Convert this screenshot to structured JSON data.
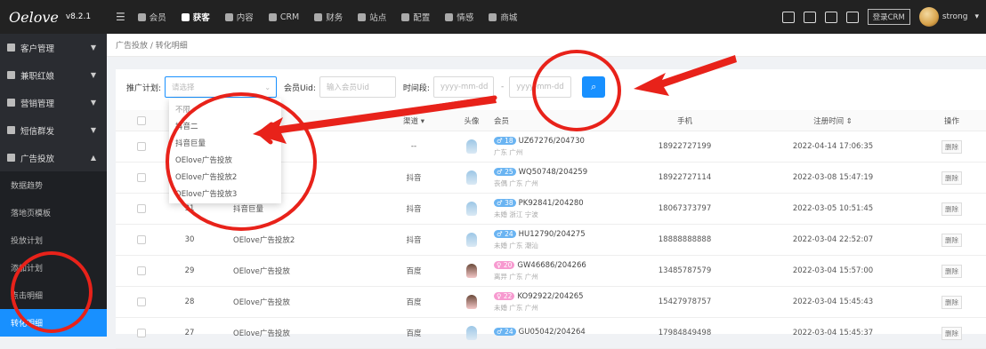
{
  "app": {
    "brand": "Oelove",
    "version": "v8.2.1"
  },
  "topnav": [
    {
      "label": "会员",
      "icon": "users-icon",
      "active": false
    },
    {
      "label": "获客",
      "icon": "user-icon",
      "active": true
    },
    {
      "label": "内容",
      "icon": "content-icon",
      "active": false
    },
    {
      "label": "CRM",
      "icon": "crm-icon",
      "active": false
    },
    {
      "label": "财务",
      "icon": "finance-icon",
      "active": false
    },
    {
      "label": "站点",
      "icon": "site-icon",
      "active": false
    },
    {
      "label": "配置",
      "icon": "gear-icon",
      "active": false
    },
    {
      "label": "情感",
      "icon": "heart-icon",
      "active": false
    },
    {
      "label": "商城",
      "icon": "shop-icon",
      "active": false
    }
  ],
  "topright": {
    "crm_login": "登录CRM",
    "username": "strong"
  },
  "sidebar": {
    "groups": [
      {
        "label": "客户管理",
        "icon": "users-icon"
      },
      {
        "label": "兼职红娘",
        "icon": "matchmaker-icon"
      },
      {
        "label": "营销管理",
        "icon": "chart-icon"
      },
      {
        "label": "短信群发",
        "icon": "sms-icon"
      },
      {
        "label": "广告投放",
        "icon": "megaphone-icon"
      }
    ],
    "subitems": [
      "数据趋势",
      "落地页模板",
      "投放计划",
      "添加计划",
      "点击明细",
      "转化明细"
    ]
  },
  "breadcrumb": "广告投放 / 转化明细",
  "filter": {
    "plan_label": "推广计划:",
    "plan_placeholder": "请选择",
    "uid_label": "会员Uid:",
    "uid_placeholder": "输入会员Uid",
    "period_label": "时间段:",
    "date_placeholder": "yyyy-mm-dd",
    "sep": "-"
  },
  "dropdown_options": [
    "不限",
    "抖音二",
    "抖音巨量",
    "OElove广告投放",
    "OElove广告投放2",
    "OElove广告投放3"
  ],
  "table": {
    "headers": {
      "channel": "渠道 ▾",
      "head": "头像",
      "member": "会员",
      "phone": "手机",
      "time": "注册时间 ⇕",
      "op": "操作"
    },
    "rows": [
      {
        "id": "",
        "plan": "",
        "channel": "--",
        "sex": "m",
        "age": "♂ 18",
        "member": "UZ67276/204730",
        "loc": "广东 广州",
        "phone": "18922727199",
        "time": "2022-04-14 17:06:35"
      },
      {
        "id": "",
        "plan": "投放2",
        "channel": "抖音",
        "sex": "m",
        "age": "♂ 25",
        "member": "WQ50748/204259",
        "loc": "丧偶 广东 广州",
        "phone": "18922727114",
        "time": "2022-03-08 15:47:19"
      },
      {
        "id": "31",
        "plan": "抖音巨量",
        "channel": "抖音",
        "sex": "m",
        "age": "♂ 38",
        "member": "PK92841/204280",
        "loc": "未婚 浙江 宁波",
        "phone": "18067373797",
        "time": "2022-03-05 10:51:45"
      },
      {
        "id": "30",
        "plan": "OElove广告投放2",
        "channel": "抖音",
        "sex": "m",
        "age": "♂ 24",
        "member": "HU12790/204275",
        "loc": "未婚 广东 潮汕",
        "phone": "18888888888",
        "time": "2022-03-04 22:52:07"
      },
      {
        "id": "29",
        "plan": "OElove广告投放",
        "channel": "百度",
        "sex": "f",
        "age": "♀ 20",
        "member": "GW46686/204266",
        "loc": "离异 广东 广州",
        "phone": "13485787579",
        "time": "2022-03-04 15:57:00"
      },
      {
        "id": "28",
        "plan": "OElove广告投放",
        "channel": "百度",
        "sex": "f",
        "age": "♀ 22",
        "member": "KO92922/204265",
        "loc": "未婚 广东 广州",
        "phone": "15427978757",
        "time": "2022-03-04 15:45:43"
      },
      {
        "id": "27",
        "plan": "OElove广告投放",
        "channel": "百度",
        "sex": "m",
        "age": "♂ 24",
        "member": "GU05042/204264",
        "loc": "",
        "phone": "17984849498",
        "time": "2022-03-04 15:45:37"
      }
    ],
    "delete_label": "删除"
  },
  "colors": {
    "accent": "#1890ff",
    "annotation": "#e8221a",
    "topbar": "#222222",
    "sidebar": "#2a2c31"
  }
}
